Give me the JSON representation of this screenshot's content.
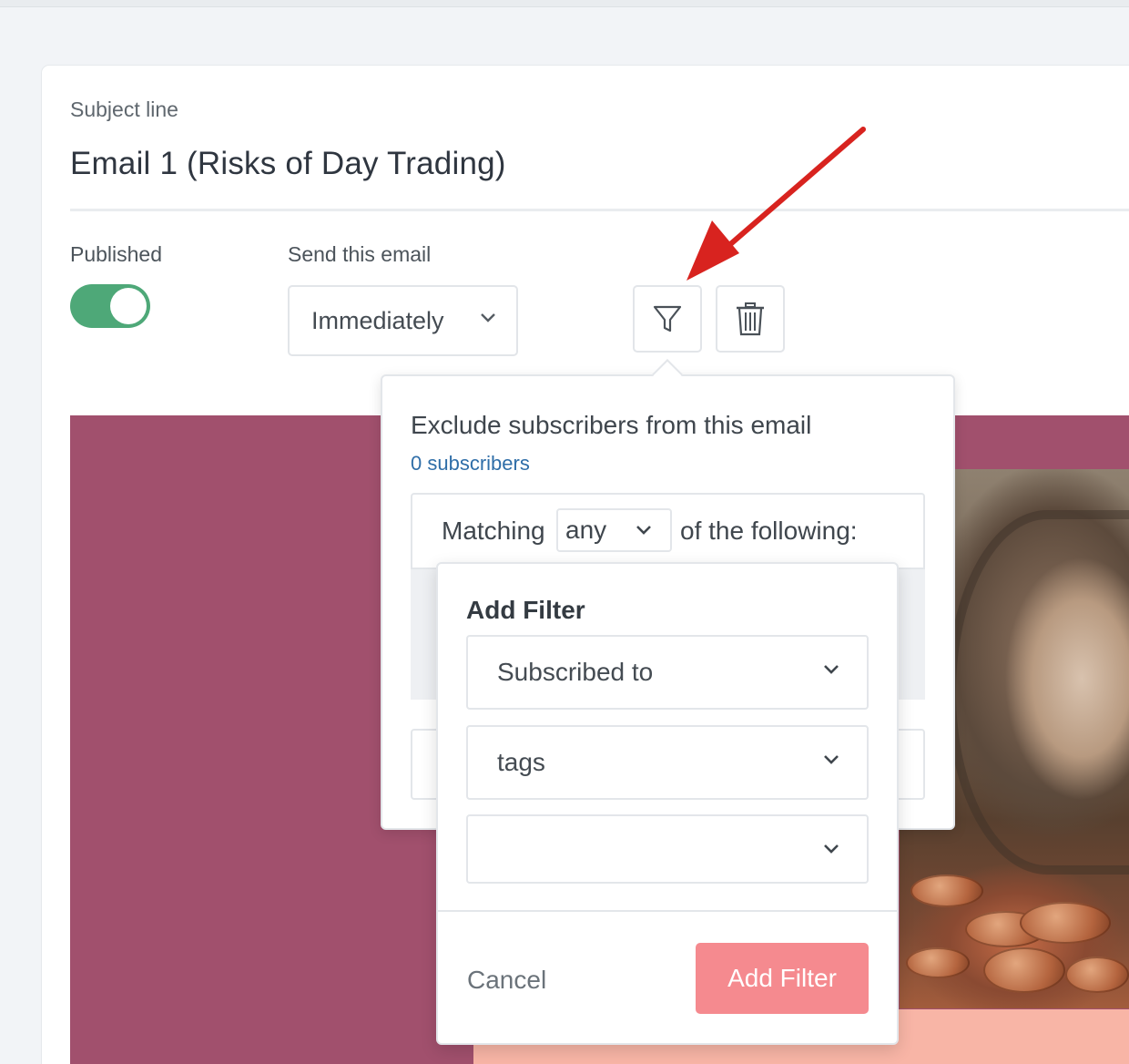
{
  "editor": {
    "subject_label": "Subject line",
    "subject_value": "Email 1 (Risks of Day Trading)",
    "published_label": "Published",
    "published_on": true,
    "send_label": "Send this email",
    "send_value": "Immediately"
  },
  "toolbar": {
    "filter_icon": "filter-icon",
    "delete_icon": "trash-icon"
  },
  "exclude_popover": {
    "title": "Exclude subscribers from this email",
    "count": "0 subscribers",
    "matching_prefix": "Matching",
    "matching_value": "any",
    "matching_suffix": "of the following:"
  },
  "add_filter": {
    "title": "Add Filter",
    "field1": "Subscribed to",
    "field2": "tags",
    "field3": "",
    "cancel_label": "Cancel",
    "submit_label": "Add Filter"
  },
  "colors": {
    "toggle_on": "#4ea878",
    "email_background": "#a1506d",
    "add_filter_button": "#f58a8f",
    "annotation_arrow": "#d8231f",
    "link": "#2f6ea8"
  }
}
